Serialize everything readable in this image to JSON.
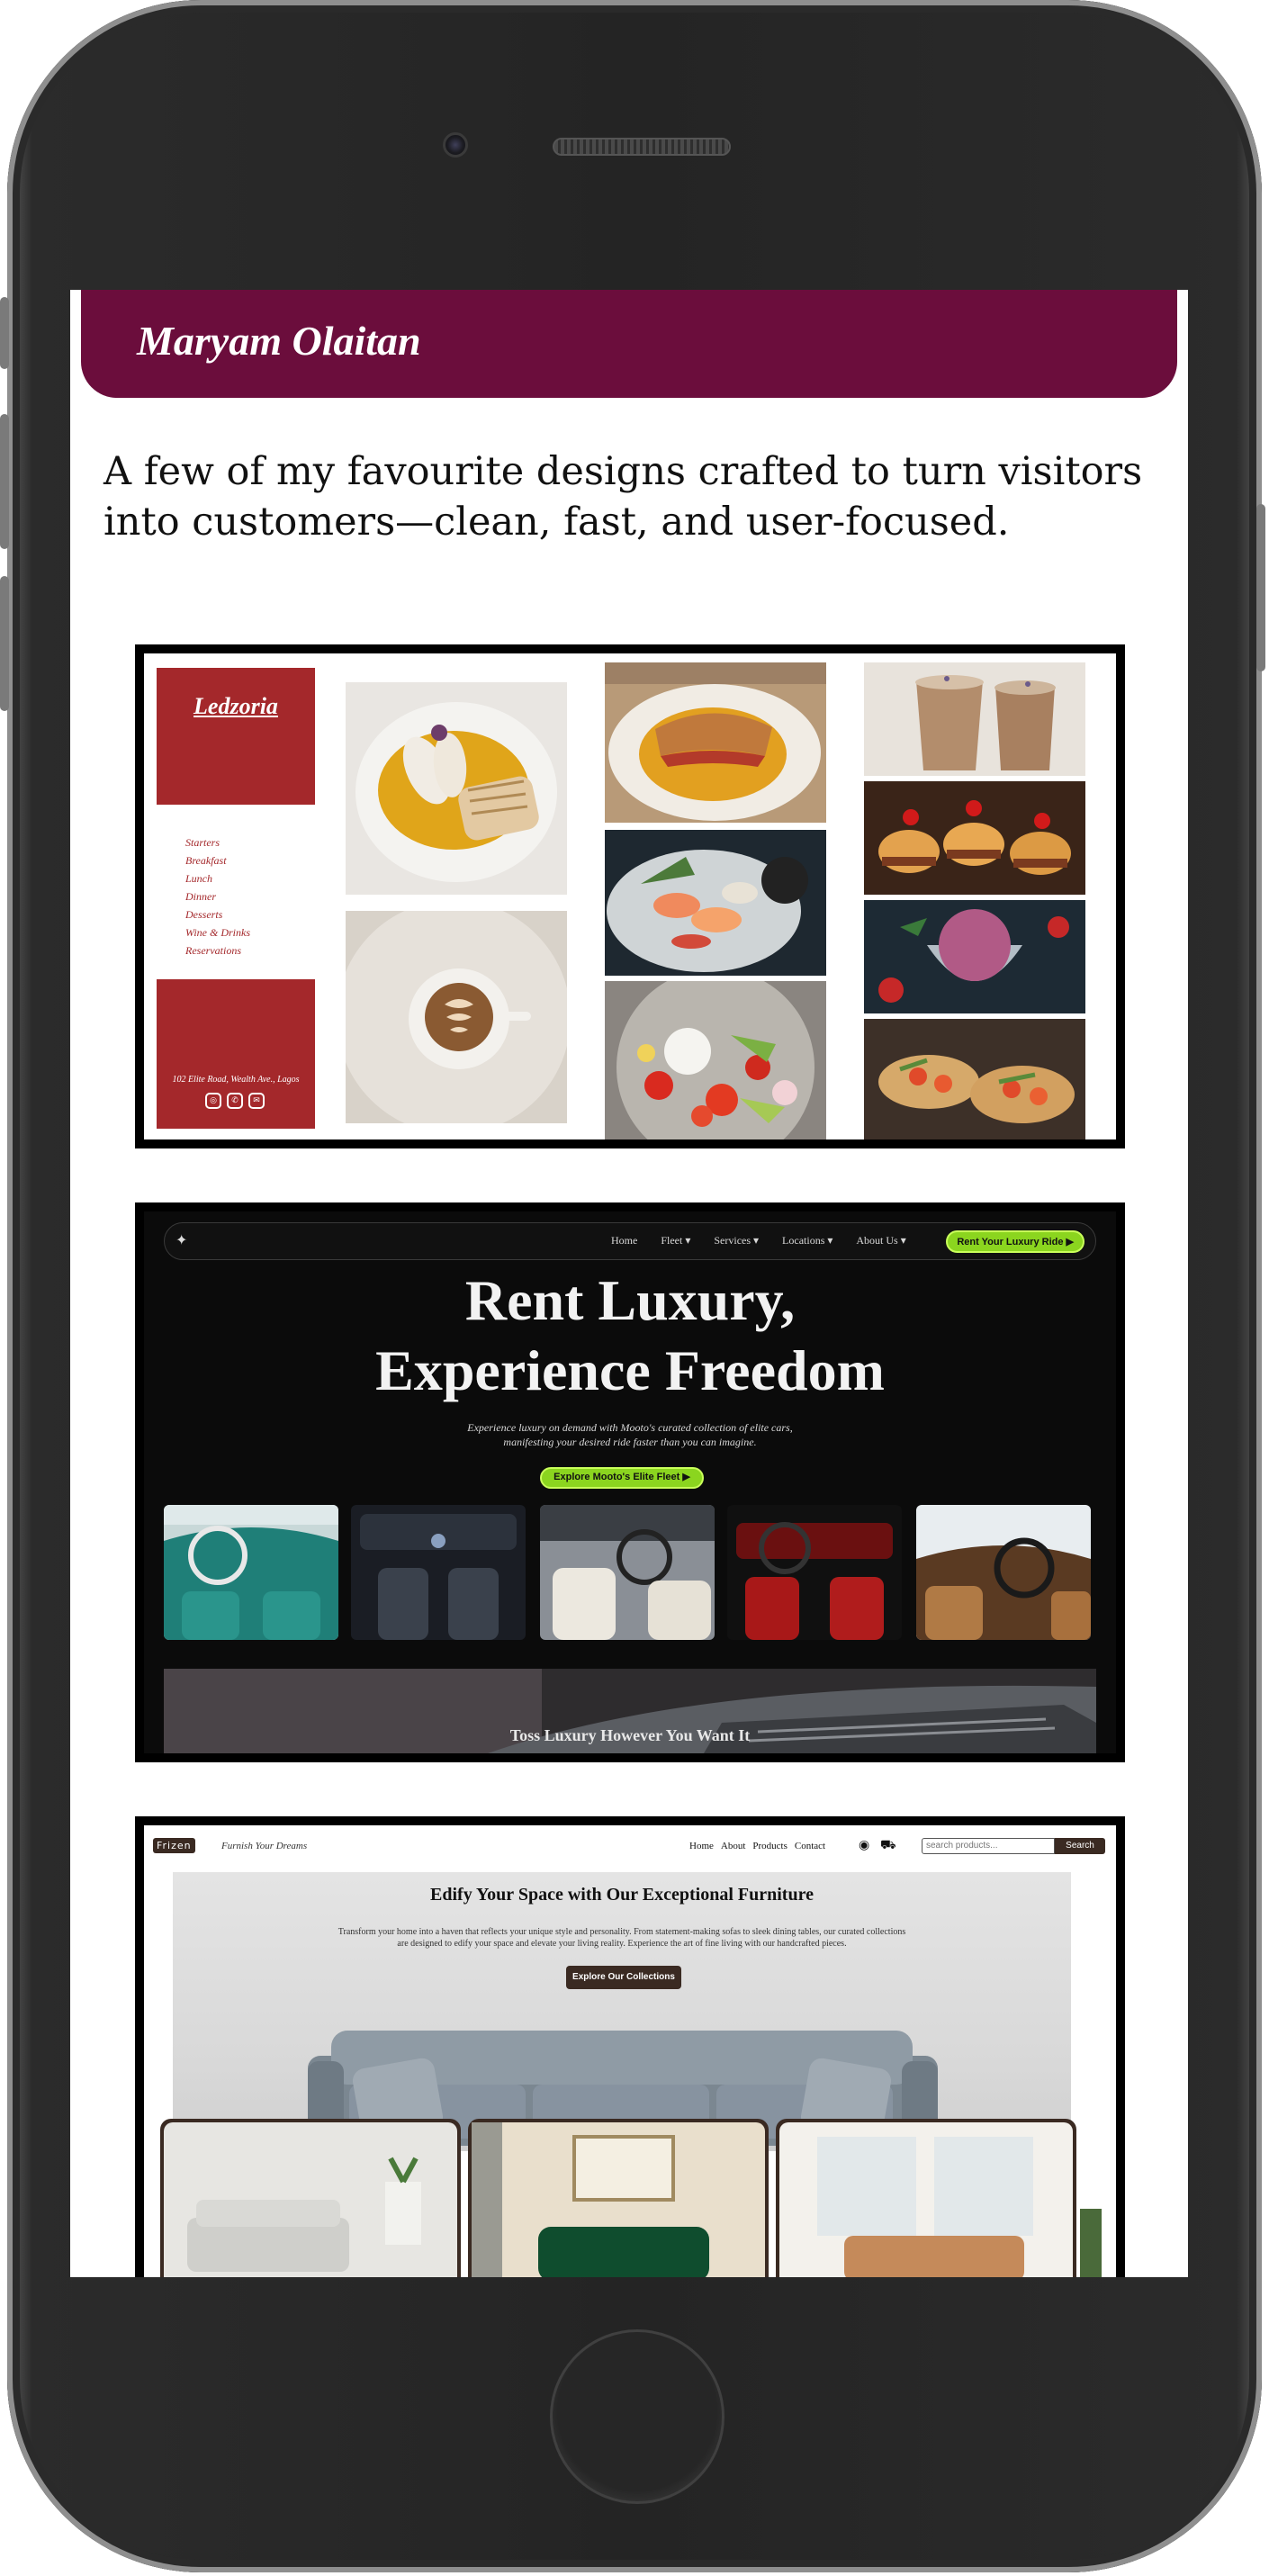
{
  "profile": {
    "name": "Maryam Olaitan"
  },
  "intro": "A few of my favourite designs crafted to turn visitors into customers—clean, fast, and user-focused.",
  "colors": {
    "header": "#6b0d3c",
    "restaurant_red": "#a4282b",
    "lime": "#8bd51f",
    "furniture_brown": "#3a2a22"
  },
  "project_restaurant": {
    "logo": "Ledzoria",
    "menu": [
      "Starters",
      "Breakfast",
      "Lunch",
      "Dinner",
      "Desserts",
      "Wine & Drinks",
      "Reservations"
    ],
    "address": "102 Elite Road, Wealth Ave., Lagos",
    "social_icons": [
      "instagram-icon",
      "whatsapp-icon",
      "mail-icon"
    ]
  },
  "project_cars": {
    "nav": [
      "Home",
      "Fleet ▾",
      "Services ▾",
      "Locations ▾",
      "About Us ▾"
    ],
    "cta": "Rent Your Luxury Ride ▶",
    "hero_line1": "Rent Luxury,",
    "hero_line2": "Experience Freedom",
    "subtitle_line1": "Experience luxury on demand with Mooto's curated collection of elite cars,",
    "subtitle_line2": "manifesting your desired ride faster than you can imagine.",
    "explore": "Explore Mooto's Elite Fleet ▶",
    "banner": "Toss Luxury However You Want It"
  },
  "project_furniture": {
    "brand": "Frizen",
    "tagline": "Furnish Your Dreams",
    "nav": [
      "Home",
      "About",
      "Products",
      "Contact"
    ],
    "search_placeholder": "search products...",
    "search_button": "Search",
    "hero_title": "Edify Your Space with Our Exceptional Furniture",
    "hero_desc_line1": "Transform your home into a haven that reflects your unique style and personality. From statement-making sofas to sleek dining tables, our curated collections",
    "hero_desc_line2": "are designed to edify your space and elevate your living reality. Experience the art of fine living with our handcrafted pieces.",
    "hero_button": "Explore Our Collections"
  }
}
